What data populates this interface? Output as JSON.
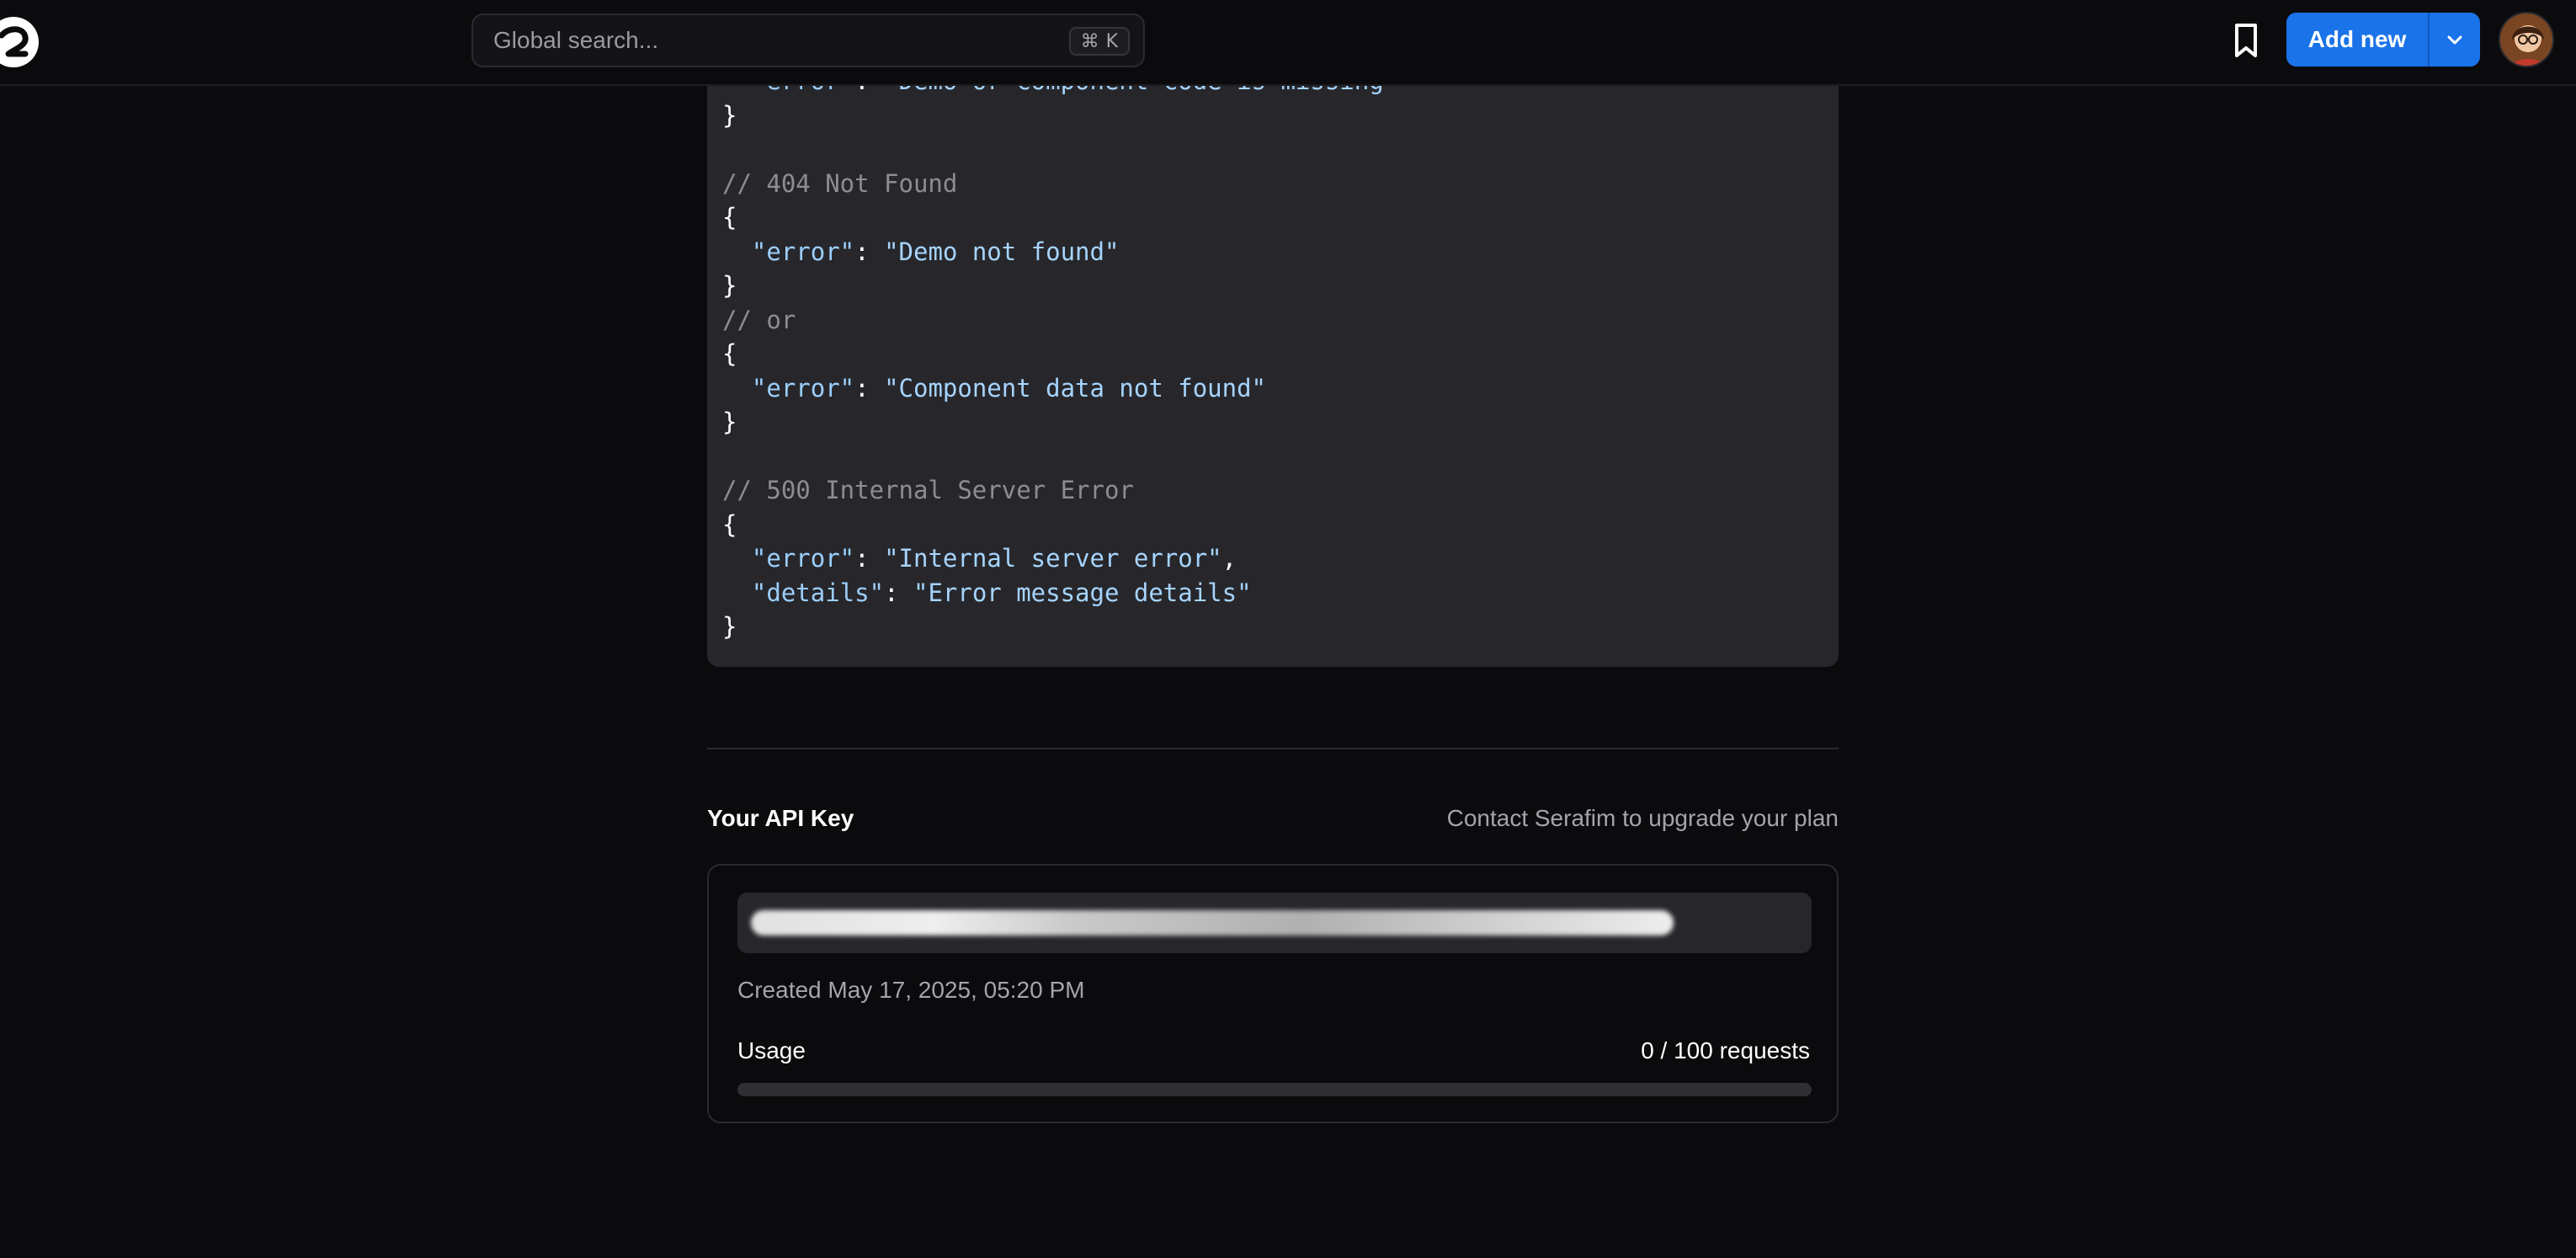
{
  "header": {
    "search_placeholder": "Global search...",
    "search_shortcut_symbol": "⌘",
    "search_shortcut_key": "K",
    "add_new_label": "Add new",
    "accent_color": "#1a73e8"
  },
  "code_lines": [
    {
      "parts": [
        {
          "t": "  ",
          "c": "plain"
        },
        {
          "t": "\"error\"",
          "c": "key"
        },
        {
          "t": ": ",
          "c": "plain"
        },
        {
          "t": "\"Demo or component code is missing\"",
          "c": "str"
        }
      ]
    },
    {
      "parts": [
        {
          "t": "}",
          "c": "plain"
        }
      ]
    },
    {
      "parts": [
        {
          "t": "",
          "c": "plain"
        }
      ]
    },
    {
      "parts": [
        {
          "t": "// 404 Not Found",
          "c": "comment"
        }
      ]
    },
    {
      "parts": [
        {
          "t": "{",
          "c": "plain"
        }
      ]
    },
    {
      "parts": [
        {
          "t": "  ",
          "c": "plain"
        },
        {
          "t": "\"error\"",
          "c": "key"
        },
        {
          "t": ": ",
          "c": "plain"
        },
        {
          "t": "\"Demo not found\"",
          "c": "str"
        }
      ]
    },
    {
      "parts": [
        {
          "t": "}",
          "c": "plain"
        }
      ]
    },
    {
      "parts": [
        {
          "t": "// or",
          "c": "comment"
        }
      ]
    },
    {
      "parts": [
        {
          "t": "{",
          "c": "plain"
        }
      ]
    },
    {
      "parts": [
        {
          "t": "  ",
          "c": "plain"
        },
        {
          "t": "\"error\"",
          "c": "key"
        },
        {
          "t": ": ",
          "c": "plain"
        },
        {
          "t": "\"Component data not found\"",
          "c": "str"
        }
      ]
    },
    {
      "parts": [
        {
          "t": "}",
          "c": "plain"
        }
      ]
    },
    {
      "parts": [
        {
          "t": "",
          "c": "plain"
        }
      ]
    },
    {
      "parts": [
        {
          "t": "// 500 Internal Server Error",
          "c": "comment"
        }
      ]
    },
    {
      "parts": [
        {
          "t": "{",
          "c": "plain"
        }
      ]
    },
    {
      "parts": [
        {
          "t": "  ",
          "c": "plain"
        },
        {
          "t": "\"error\"",
          "c": "key"
        },
        {
          "t": ": ",
          "c": "plain"
        },
        {
          "t": "\"Internal server error\"",
          "c": "str"
        },
        {
          "t": ",",
          "c": "plain"
        }
      ]
    },
    {
      "parts": [
        {
          "t": "  ",
          "c": "plain"
        },
        {
          "t": "\"details\"",
          "c": "key"
        },
        {
          "t": ": ",
          "c": "plain"
        },
        {
          "t": "\"Error message details\"",
          "c": "str"
        }
      ]
    },
    {
      "parts": [
        {
          "t": "}",
          "c": "plain"
        }
      ]
    }
  ],
  "api": {
    "title": "Your API Key",
    "contact_text": "Contact Serafim to upgrade your plan",
    "created_text": "Created May 17, 2025, 05:20 PM",
    "usage_label": "Usage",
    "usage_count": "0 / 100 requests",
    "usage_fraction": 0
  },
  "icons": {
    "logo": "logo-icon",
    "bookmark": "bookmark-icon",
    "caret": "chevron-down-icon",
    "avatar": "avatar"
  }
}
